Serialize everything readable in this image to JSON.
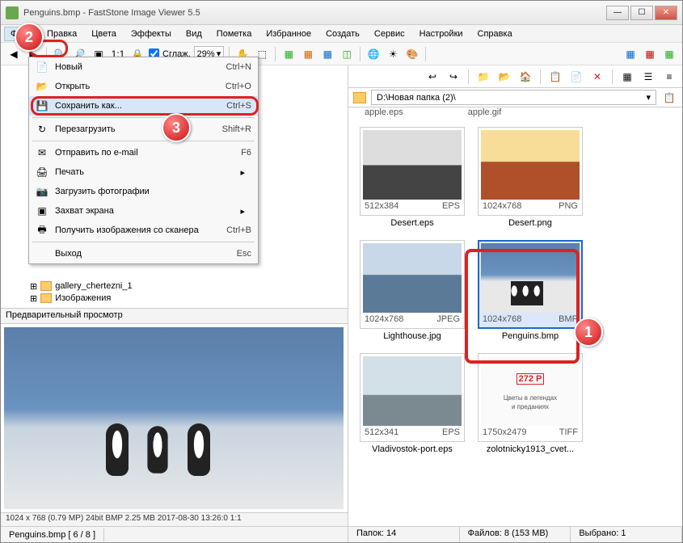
{
  "window": {
    "title": "Penguins.bmp  -  FastStone Image Viewer 5.5"
  },
  "menubar": [
    "Файл",
    "Правка",
    "Цвета",
    "Эффекты",
    "Вид",
    "Пометка",
    "Избранное",
    "Создать",
    "Сервис",
    "Настройки",
    "Справка"
  ],
  "toolbar": {
    "smooth_label": "Сглаж.",
    "zoom": "29%"
  },
  "dropdown": [
    {
      "icon": "📄",
      "label": "Новый",
      "sc": "Ctrl+N"
    },
    {
      "icon": "📂",
      "label": "Открыть",
      "sc": "Ctrl+O"
    },
    {
      "icon": "💾",
      "label": "Сохранить как...",
      "sc": "Ctrl+S",
      "hover": true
    },
    {
      "sep": true
    },
    {
      "icon": "↻",
      "label": "Перезагрузить",
      "sc": "Shift+R"
    },
    {
      "sep": true
    },
    {
      "icon": "✉",
      "label": "Отправить по e-mail",
      "sc": "F6"
    },
    {
      "icon": "🖨",
      "label": "Печать",
      "sc": "",
      "sub": true
    },
    {
      "icon": "📷",
      "label": "Загрузить фотографии",
      "sc": ""
    },
    {
      "icon": "▣",
      "label": "Захват экрана",
      "sc": "",
      "sub": true
    },
    {
      "icon": "🖶",
      "label": "Получить изображения со сканера",
      "sc": "Ctrl+B"
    },
    {
      "sep": true
    },
    {
      "icon": "",
      "label": "Выход",
      "sc": "Esc"
    }
  ],
  "tree": [
    {
      "label": "gallery_chertezni_1"
    },
    {
      "label": "Изображения"
    }
  ],
  "preview_header": "Предварительный просмотр",
  "path": "D:\\Новая папка (2)\\",
  "thumbs_header": {
    "c1": "apple.eps",
    "c2": "apple.gif"
  },
  "thumbs": [
    {
      "dim": "512x384",
      "fmt": "EPS",
      "label": "Desert.eps",
      "cls": "img-bw"
    },
    {
      "dim": "1024x768",
      "fmt": "PNG",
      "label": "Desert.png",
      "cls": "img-desert"
    },
    {
      "dim": "1024x768",
      "fmt": "JPEG",
      "label": "Lighthouse.jpg",
      "cls": "img-sea"
    },
    {
      "dim": "1024x768",
      "fmt": "BMP",
      "label": "Penguins.bmp",
      "cls": "img-peng",
      "selected": true
    },
    {
      "dim": "512x341",
      "fmt": "EPS",
      "label": "Vladivostok-port.eps",
      "cls": "img-port"
    },
    {
      "dim": "1750x2479",
      "fmt": "TIFF",
      "label": "zolotnicky1913_cvet...",
      "cls": "img-book",
      "price": "272 Р",
      "book1": "Цветы в легендах",
      "book2": "и преданиях"
    }
  ],
  "info_line": "1024 x 768 (0.79 MP)  24bit  BMP   2.25 MB   2017-08-30  13:26:0  1:1",
  "status_left": "Penguins.bmp [ 6 / 8 ]",
  "status_right": {
    "folders": "Папок: 14",
    "files": "Файлов: 8 (153 MB)",
    "sel": "Выбрано: 1"
  },
  "callouts": {
    "c1": "1",
    "c2": "2",
    "c3": "3"
  }
}
